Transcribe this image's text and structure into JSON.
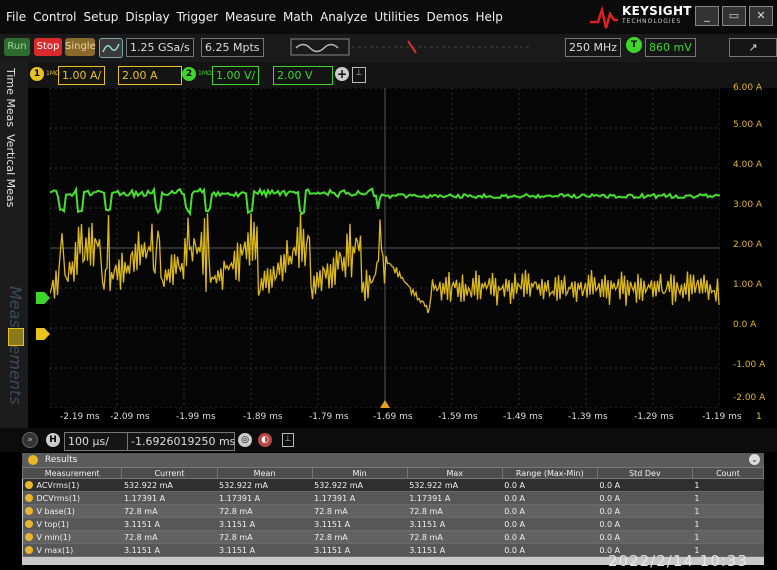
{
  "menu": [
    "File",
    "Control",
    "Setup",
    "Display",
    "Trigger",
    "Measure",
    "Math",
    "Analyze",
    "Utilities",
    "Demos",
    "Help"
  ],
  "brand": {
    "name": "KEYSIGHT",
    "sub": "TECHNOLOGIES"
  },
  "controls": {
    "run": "Run",
    "stop": "Stop",
    "single": "Single",
    "sample_rate": "1.25 GSa/s",
    "memory_depth": "6.25 Mpts",
    "bandwidth": "250 MHz",
    "trigger_channel": "T",
    "trigger_level": "860 mV"
  },
  "channels": {
    "ch1": {
      "number": "1",
      "impedance": "1MΩ",
      "scale": "1.00 A/",
      "offset": "2.00 A",
      "color": "#e8c21e"
    },
    "ch2": {
      "number": "2",
      "impedance": "1MΩ",
      "scale": "1.00 V/",
      "offset": "2.00 V",
      "color": "#3fd62b"
    }
  },
  "side_tabs": {
    "time_meas": "Time Meas",
    "vertical_meas": "Vertical Meas",
    "measurements": "Measurements"
  },
  "y_axis_labels": [
    "6.00 A",
    "5.00 A",
    "4.00 A",
    "3.00 A",
    "2.00 A",
    "1.00 A",
    "0.0 A",
    "-1.00 A",
    "-2.00 A"
  ],
  "x_axis_labels": [
    "-2.19 ms",
    "-2.09 ms",
    "-1.99 ms",
    "-1.89 ms",
    "-1.79 ms",
    "-1.69 ms",
    "-1.59 ms",
    "-1.49 ms",
    "-1.39 ms",
    "-1.29 ms",
    "-1.19 ms"
  ],
  "x_axis_channel": "1",
  "timebase": {
    "label": "H",
    "scale": "100 µs/",
    "position": "-1.6926019250 ms"
  },
  "results": {
    "title": "Results",
    "headers": [
      "Measurement",
      "Current",
      "Mean",
      "Min",
      "Max",
      "Range (Max-Min)",
      "Std Dev",
      "Count"
    ],
    "rows": [
      [
        "ACVrms(1)",
        "532.922 mA",
        "532.922 mA",
        "532.922 mA",
        "532.922 mA",
        "0.0 A",
        "0.0 A",
        "1"
      ],
      [
        "DCVrms(1)",
        "1.17391 A",
        "1.17391 A",
        "1.17391 A",
        "1.17391 A",
        "0.0 A",
        "0.0 A",
        "1"
      ],
      [
        "V base(1)",
        "72.8 mA",
        "72.8 mA",
        "72.8 mA",
        "72.8 mA",
        "0.0 A",
        "0.0 A",
        "1"
      ],
      [
        "V top(1)",
        "3.1151 A",
        "3.1151 A",
        "3.1151 A",
        "3.1151 A",
        "0.0 A",
        "0.0 A",
        "1"
      ],
      [
        "V min(1)",
        "72.8 mA",
        "72.8 mA",
        "72.8 mA",
        "72.8 mA",
        "0.0 A",
        "0.0 A",
        "1"
      ],
      [
        "V max(1)",
        "3.1151 A",
        "3.1151 A",
        "3.1151 A",
        "3.1151 A",
        "0.0 A",
        "0.0 A",
        "1"
      ]
    ]
  },
  "timestamp": "2022/2/14 10:33"
}
